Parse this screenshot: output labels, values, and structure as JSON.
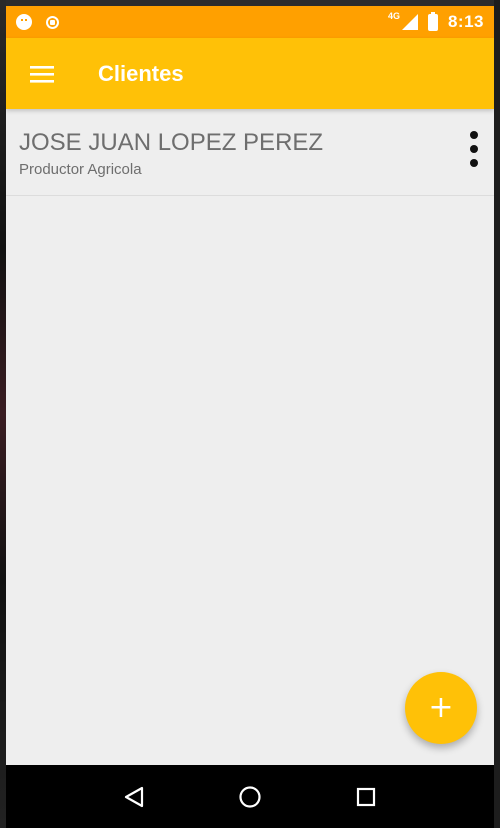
{
  "statusbar": {
    "left_icons": [
      "chat-notification-icon",
      "security-shield-icon"
    ],
    "network": "4G",
    "time": "8:13"
  },
  "appbar": {
    "title": "Clientes",
    "menu_icon": "hamburger-menu-icon"
  },
  "clients": [
    {
      "name": "JOSE JUAN LOPEZ PEREZ",
      "role": "Productor Agricola",
      "more_icon": "more-vertical-icon"
    }
  ],
  "fab": {
    "label": "+"
  },
  "navigation": {
    "buttons": [
      "back-icon",
      "home-icon",
      "recents-icon"
    ]
  },
  "colors": {
    "statusbar": "#ffa000",
    "appbar": "#ffc107",
    "accent": "#ffc107",
    "background": "#eeeeee",
    "navbar": "#000000"
  }
}
